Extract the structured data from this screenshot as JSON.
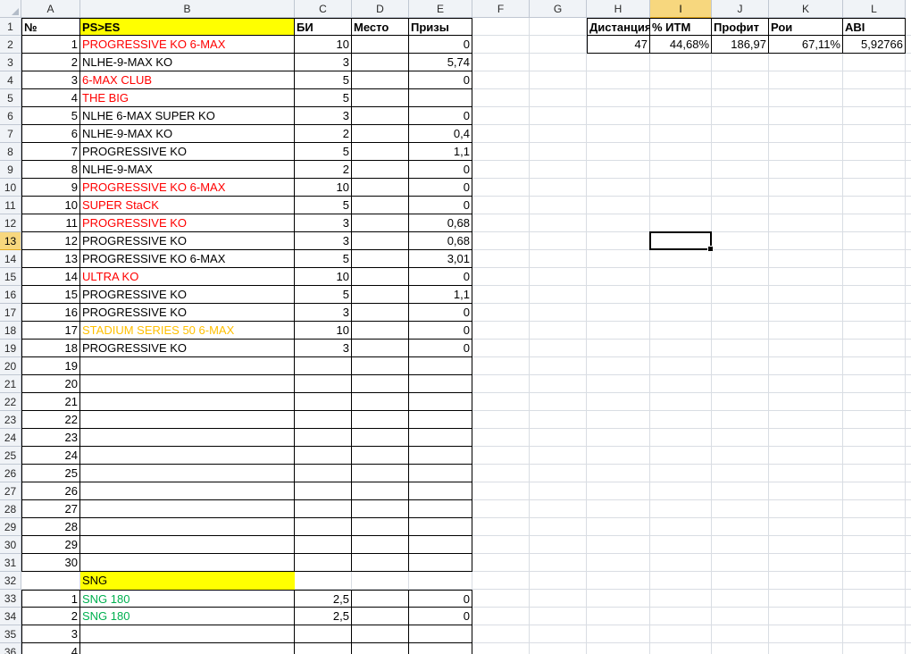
{
  "columns": [
    {
      "letter": "A",
      "w": 66
    },
    {
      "letter": "B",
      "w": 240
    },
    {
      "letter": "C",
      "w": 64
    },
    {
      "letter": "D",
      "w": 64
    },
    {
      "letter": "E",
      "w": 71
    },
    {
      "letter": "F",
      "w": 64
    },
    {
      "letter": "G",
      "w": 64
    },
    {
      "letter": "H",
      "w": 71
    },
    {
      "letter": "I",
      "w": 69
    },
    {
      "letter": "J",
      "w": 64
    },
    {
      "letter": "K",
      "w": 83
    },
    {
      "letter": "L",
      "w": 70
    }
  ],
  "header_row": [
    "№",
    "PS>ES",
    "БИ",
    "Место",
    "Призы"
  ],
  "rows": [
    {
      "n": "1",
      "name": "PROGRESSIVE KO 6-MAX",
      "color": "red",
      "bi": "10",
      "prize": "0"
    },
    {
      "n": "2",
      "name": "NLHE-9-MAX KO",
      "color": "black",
      "bi": "3",
      "prize": "5,74"
    },
    {
      "n": "3",
      "name": "6-MAX CLUB",
      "color": "red",
      "bi": "5",
      "prize": "0"
    },
    {
      "n": "4",
      "name": "THE BIG",
      "color": "red",
      "bi": "5",
      "prize": ""
    },
    {
      "n": "5",
      "name": "NLHE 6-MAX SUPER KO",
      "color": "black",
      "bi": "3",
      "prize": "0"
    },
    {
      "n": "6",
      "name": "NLHE-9-MAX KO",
      "color": "black",
      "bi": "2",
      "prize": "0,4"
    },
    {
      "n": "7",
      "name": "PROGRESSIVE KO",
      "color": "black",
      "bi": "5",
      "prize": "1,1"
    },
    {
      "n": "8",
      "name": "NLHE-9-MAX",
      "color": "black",
      "bi": "2",
      "prize": "0"
    },
    {
      "n": "9",
      "name": "PROGRESSIVE KO 6-MAX",
      "color": "red",
      "bi": "10",
      "prize": "0"
    },
    {
      "n": "10",
      "name": "SUPER StaCK",
      "color": "red",
      "bi": "5",
      "prize": "0"
    },
    {
      "n": "11",
      "name": "PROGRESSIVE KO",
      "color": "red",
      "bi": "3",
      "prize": "0,68"
    },
    {
      "n": "12",
      "name": "PROGRESSIVE KO",
      "color": "black",
      "bi": "3",
      "prize": "0,68"
    },
    {
      "n": "13",
      "name": "PROGRESSIVE KO 6-MAX",
      "color": "black",
      "bi": "5",
      "prize": "3,01"
    },
    {
      "n": "14",
      "name": "ULTRA KO",
      "color": "red",
      "bi": "10",
      "prize": "0"
    },
    {
      "n": "15",
      "name": "PROGRESSIVE KO",
      "color": "black",
      "bi": "5",
      "prize": "1,1"
    },
    {
      "n": "16",
      "name": "PROGRESSIVE KO",
      "color": "black",
      "bi": "3",
      "prize": "0"
    },
    {
      "n": "17",
      "name": "STADIUM SERIES 50 6-MAX",
      "color": "gold",
      "bi": "10",
      "prize": "0"
    },
    {
      "n": "18",
      "name": "PROGRESSIVE KO",
      "color": "black",
      "bi": "3",
      "prize": "0"
    },
    {
      "n": "19",
      "name": "",
      "color": "black",
      "bi": "",
      "prize": ""
    },
    {
      "n": "20",
      "name": "",
      "color": "black",
      "bi": "",
      "prize": ""
    },
    {
      "n": "21",
      "name": "",
      "color": "black",
      "bi": "",
      "prize": ""
    },
    {
      "n": "22",
      "name": "",
      "color": "black",
      "bi": "",
      "prize": ""
    },
    {
      "n": "23",
      "name": "",
      "color": "black",
      "bi": "",
      "prize": ""
    },
    {
      "n": "24",
      "name": "",
      "color": "black",
      "bi": "",
      "prize": ""
    },
    {
      "n": "25",
      "name": "",
      "color": "black",
      "bi": "",
      "prize": ""
    },
    {
      "n": "26",
      "name": "",
      "color": "black",
      "bi": "",
      "prize": ""
    },
    {
      "n": "27",
      "name": "",
      "color": "black",
      "bi": "",
      "prize": ""
    },
    {
      "n": "28",
      "name": "",
      "color": "black",
      "bi": "",
      "prize": ""
    },
    {
      "n": "29",
      "name": "",
      "color": "black",
      "bi": "",
      "prize": ""
    },
    {
      "n": "30",
      "name": "",
      "color": "black",
      "bi": "",
      "prize": ""
    }
  ],
  "sng_header": "SNG",
  "sng_rows": [
    {
      "n": "1",
      "name": "SNG 180",
      "color": "green",
      "bi": "2,5",
      "prize": "0"
    },
    {
      "n": "2",
      "name": "SNG 180",
      "color": "green",
      "bi": "2,5",
      "prize": "0"
    },
    {
      "n": "3",
      "name": "",
      "color": "black",
      "bi": "",
      "prize": ""
    },
    {
      "n": "4",
      "name": "",
      "color": "black",
      "bi": "",
      "prize": ""
    }
  ],
  "stats": {
    "headers": [
      "Дистанция",
      "% ИТМ",
      "Профит",
      "Рои",
      "ABI"
    ],
    "values": [
      "47",
      "44,68%",
      "186,97",
      "67,11%",
      "5,92766"
    ]
  },
  "row_count": 36,
  "selected_row": 13,
  "selected_col": "I",
  "colors": {
    "red": "#ff0000",
    "green": "#00b050",
    "gold": "#ffc000",
    "yellow": "#ffff00",
    "selection": "#f7d77e"
  }
}
